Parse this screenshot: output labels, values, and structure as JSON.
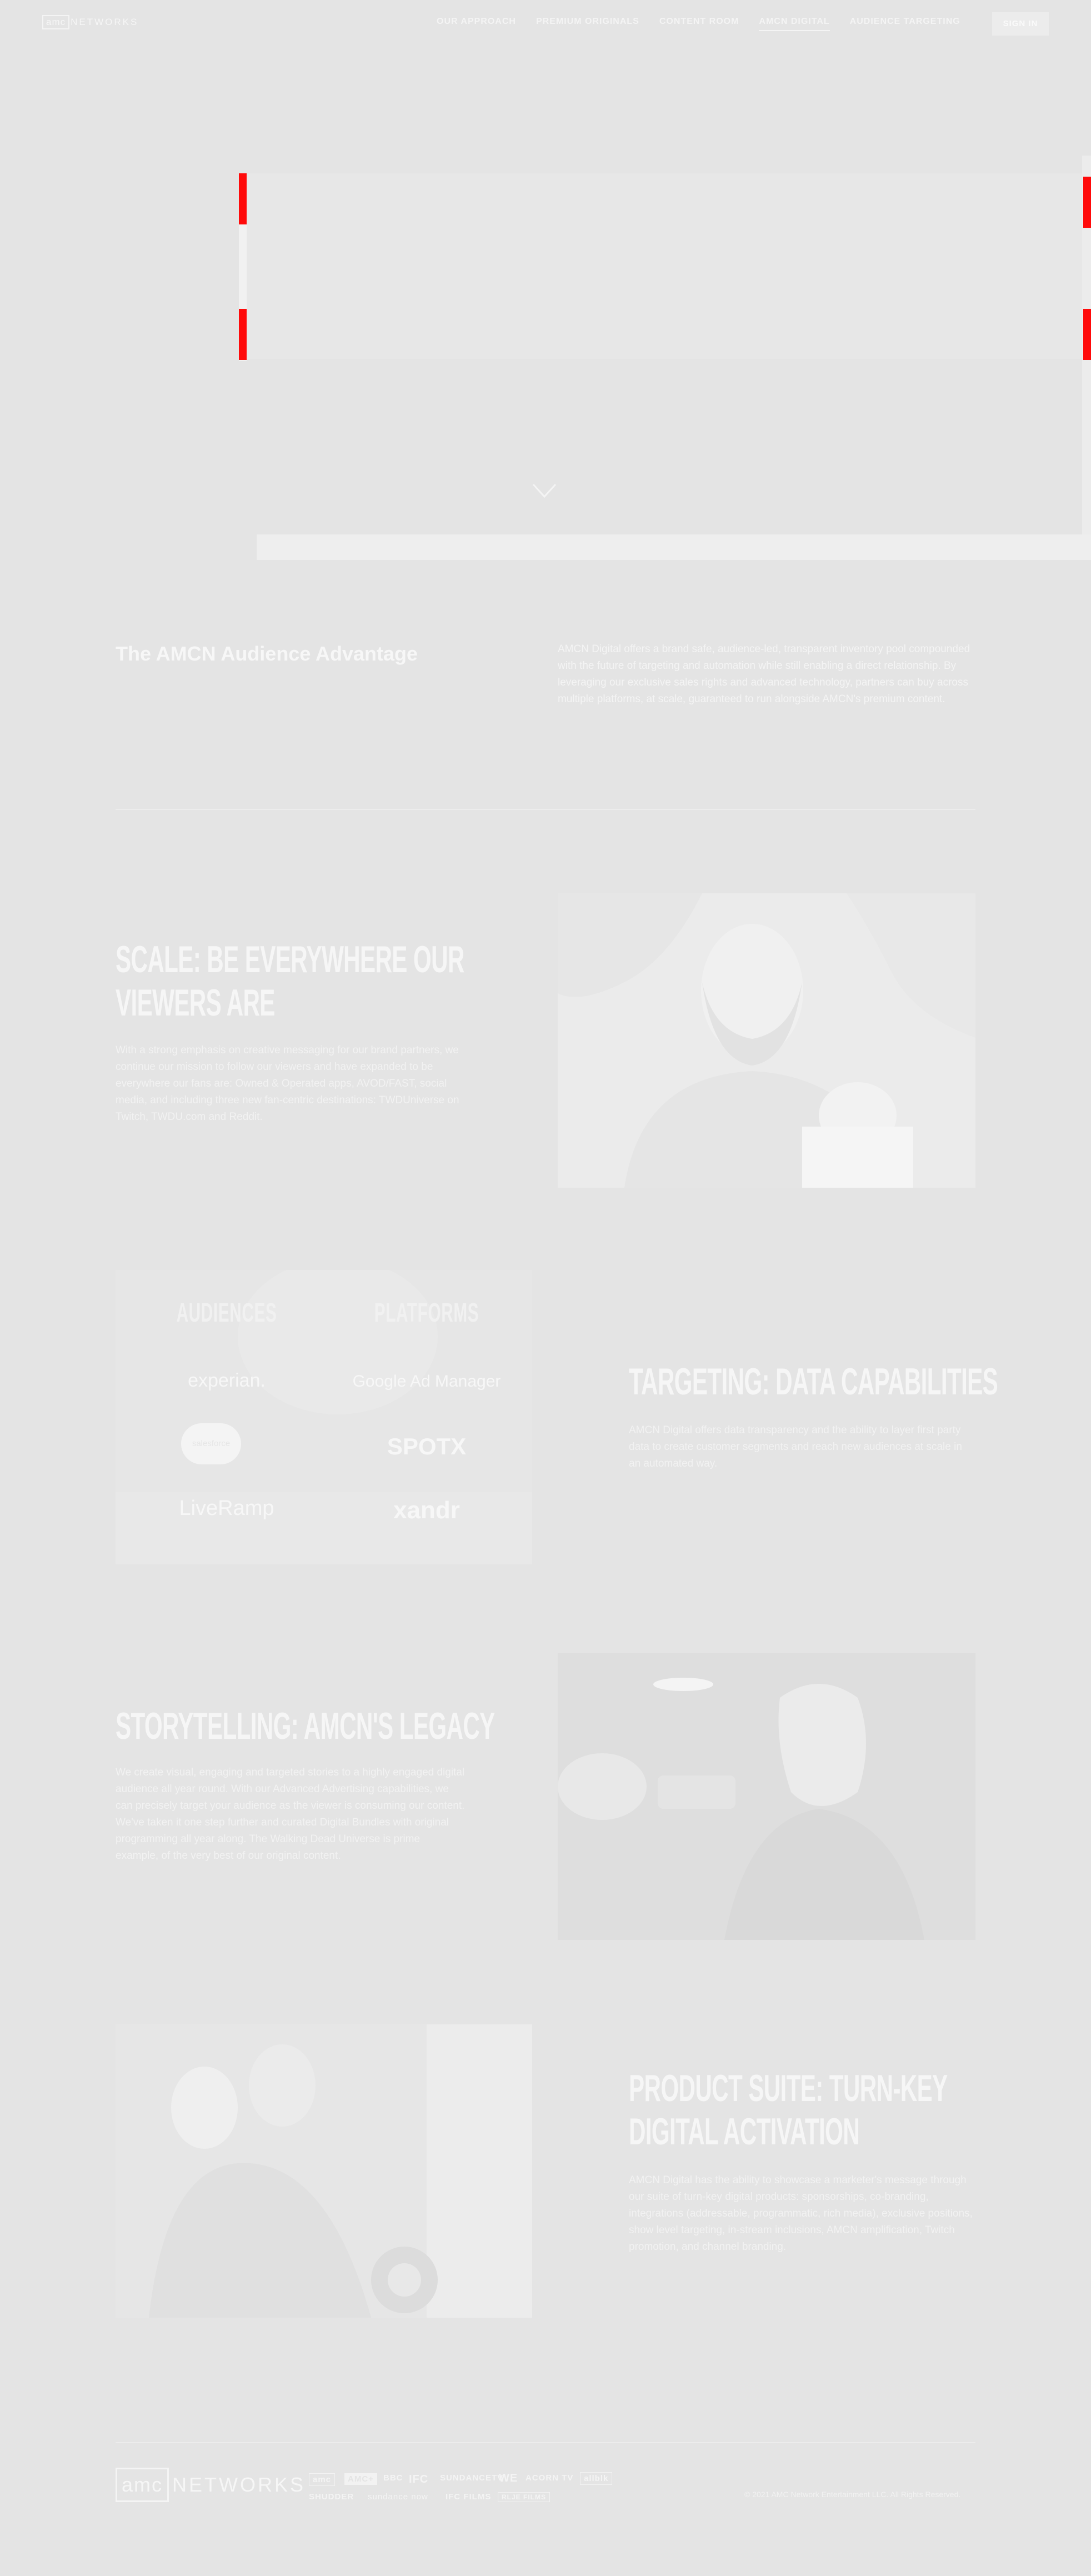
{
  "nav": {
    "logo_box": "amc",
    "logo_text": "NETWORKS",
    "links": [
      "OUR APPROACH",
      "PREMIUM ORIGINALS",
      "CONTENT ROOM",
      "AMCN DIGITAL",
      "AUDIENCE TARGETING"
    ],
    "active_index": 3,
    "signin": "SIGN IN"
  },
  "advantage": {
    "title": "The AMCN Audience Advantage",
    "text": "AMCN Digital offers a brand safe, audience-led, transparent inventory pool compounded with the future of targeting and automation while still enabling a direct relationship. By leveraging our exclusive sales rights and advanced technology, partners can buy across multiple platforms, at scale, guaranteed to run alongside AMCN's premium content."
  },
  "scale": {
    "title_line1": "SCALE: BE EVERYWHERE OUR",
    "title_line2": "VIEWERS ARE",
    "text": "With a strong emphasis on creative messaging for our brand partners, we continue our mission to follow our viewers and have expanded to be everywhere our fans are: Owned & Operated apps, AVOD/FAST, social media, and including three new fan-centric destinations: TWDUniverse on Twitch, TWDU.com and Reddit."
  },
  "targeting": {
    "title": "TARGETING: DATA CAPABILITIES",
    "text": "AMCN Digital offers data transparency and the ability to layer first party data to create customer segments and reach new audiences at scale in an automated way.",
    "col_audiences": "AUDIENCES",
    "col_platforms": "PLATFORMS",
    "audience_logos": [
      "experian.",
      "salesforce",
      "LiveRamp"
    ],
    "platform_logos": [
      "Google Ad Manager",
      "SPOTX",
      "xandr"
    ]
  },
  "storytelling": {
    "title": "STORYTELLING: AMCN'S LEGACY",
    "text": "We create visual, engaging and targeted stories to a highly engaged digital audience all year round. With our Advanced Advertising capabilities, we can precisely target your audience as the viewer is consuming our content. We've taken it one step further and curated Digital Bundles with original programming all year along. The Walking Dead Universe is prime example, of the very best of our original content."
  },
  "product": {
    "title_line1": "PRODUCT SUITE: TURN-KEY",
    "title_line2": "DIGITAL ACTIVATION",
    "text": "AMCN Digital has the ability to showcase a marketer's message through our suite of turn-key digital products: sponsorships, co-branding, integrations (addressable, programmatic, rich media), exclusive positions, show level targeting, in-stream inclusions, AMCN amplification, Twitch promotion, and channel branding."
  },
  "footer": {
    "logo_box": "amc",
    "logo_text": "NETWORKS",
    "brands_row1": [
      "amc",
      "AMC+",
      "BBC",
      "IFC",
      "SUNDANCETV",
      "WE",
      "ACORN TV",
      "allblk"
    ],
    "brands_row2": [
      "SHUDDER",
      "sundance now",
      "IFC FILMS",
      "RLJE FILMS"
    ],
    "copyright": "© 2021 AMC Network Entertainment LLC. All Rights Reserved."
  },
  "colors": {
    "background": "#e4e4e4",
    "accent_red": "#ff0a0a",
    "text_light": "#f6f6f6"
  }
}
